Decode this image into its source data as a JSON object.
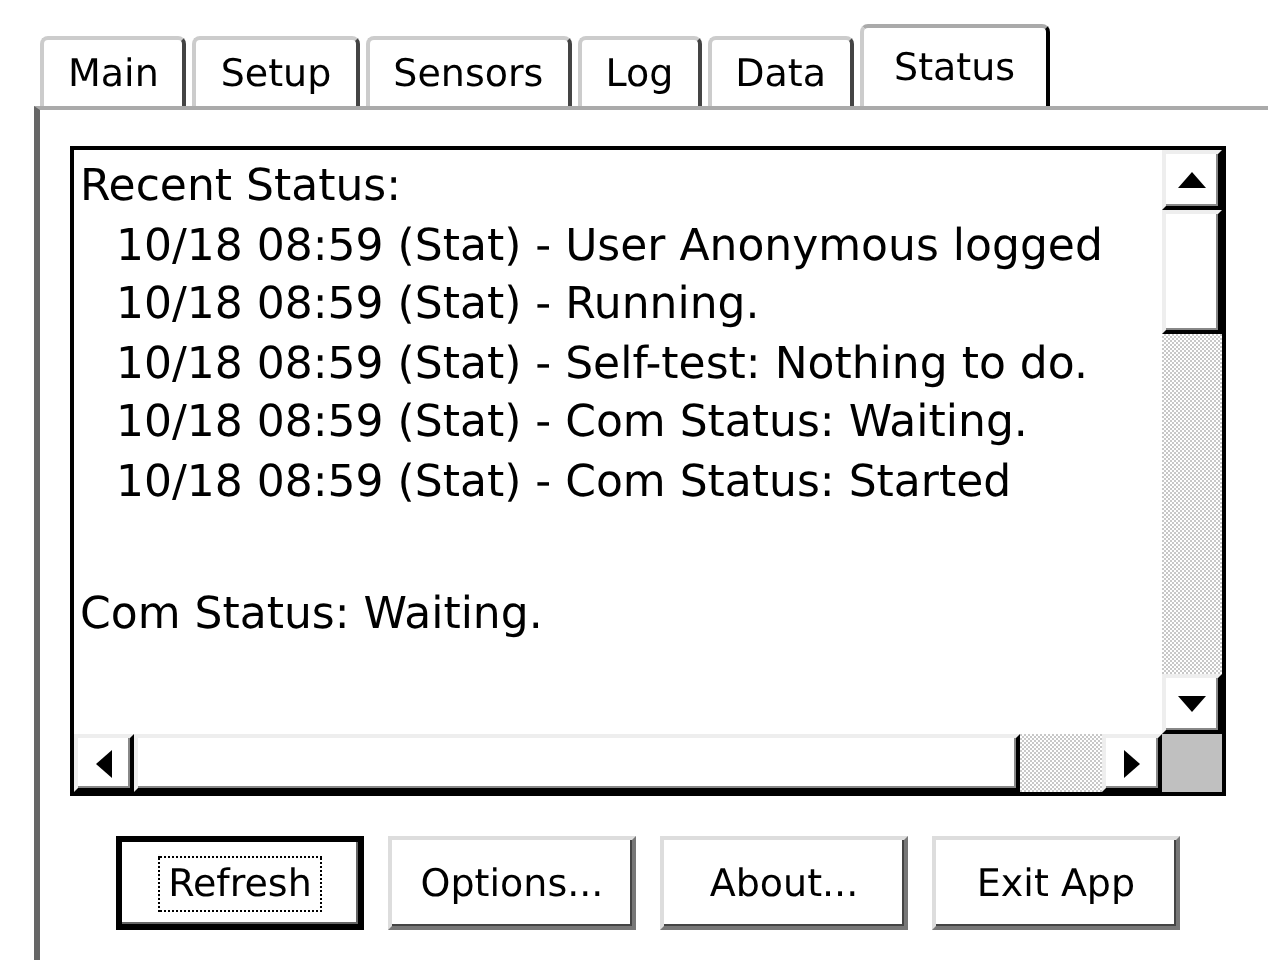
{
  "tabs": [
    {
      "label": "Main",
      "selected": false
    },
    {
      "label": "Setup",
      "selected": false
    },
    {
      "label": "Sensors",
      "selected": false
    },
    {
      "label": "Log",
      "selected": false
    },
    {
      "label": "Data",
      "selected": false
    },
    {
      "label": "Status",
      "selected": true
    }
  ],
  "status_log": {
    "lines": [
      {
        "kind": "header",
        "text": "Recent Status:"
      },
      {
        "kind": "entry",
        "text": "10/18 08:59 (Stat) - User Anonymous logged"
      },
      {
        "kind": "entry",
        "text": "10/18 08:59 (Stat) - Running."
      },
      {
        "kind": "entry",
        "text": "10/18 08:59 (Stat) - Self-test: Nothing to do."
      },
      {
        "kind": "entry",
        "text": "10/18 08:59 (Stat) - Com Status: Waiting."
      },
      {
        "kind": "entry",
        "text": "10/18 08:59 (Stat) - Com Status: Started"
      },
      {
        "kind": "blank"
      },
      {
        "kind": "header",
        "text": "Com Status: Waiting."
      }
    ]
  },
  "buttons": [
    {
      "label": "Refresh",
      "focused": true
    },
    {
      "label": "Options...",
      "focused": false
    },
    {
      "label": "About...",
      "focused": false
    },
    {
      "label": "Exit App",
      "focused": false
    }
  ]
}
